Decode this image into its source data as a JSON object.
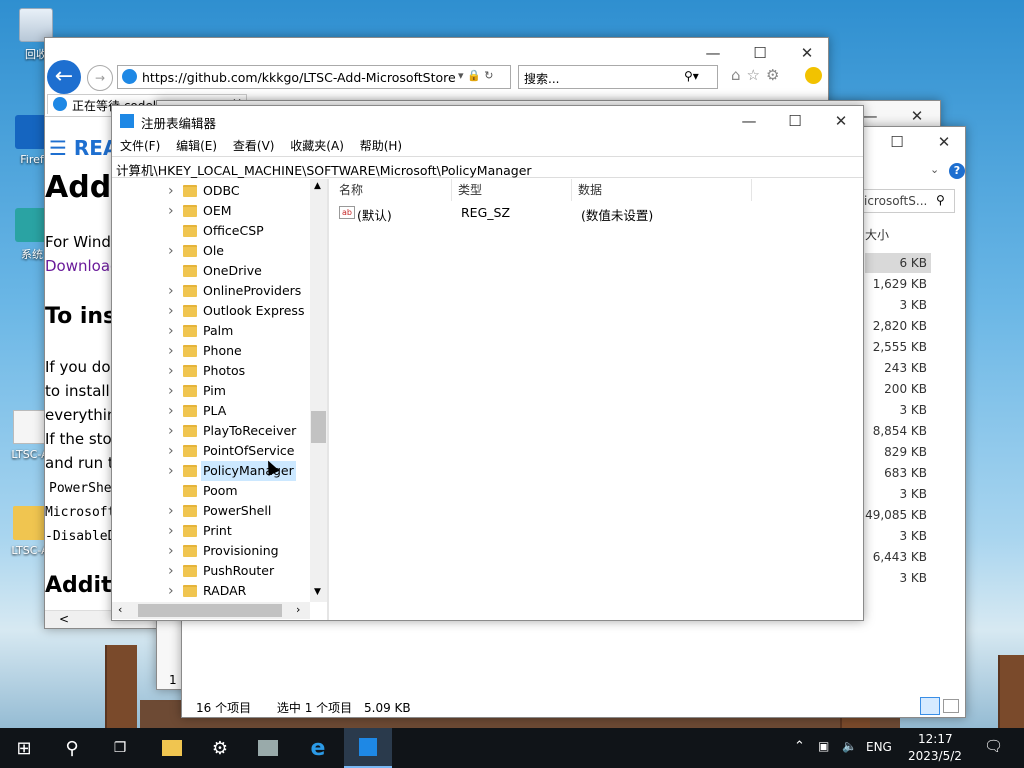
{
  "desktop": {
    "icons": [
      {
        "label": "回收"
      },
      {
        "label": "Firef"
      },
      {
        "label": "系统"
      },
      {
        "label": "LTSC-A"
      },
      {
        "label": "LTSC-A"
      }
    ]
  },
  "browser": {
    "url": "https://github.com/kkkgo/LTSC-Add-MicrosoftStore",
    "search_placeholder": "搜索...",
    "tab_label": "正在等待 codeload.githu",
    "page": {
      "readme": "REA",
      "heading": "Add",
      "line1": "For Windo",
      "download_link": "Download",
      "h2": "To ins",
      "p1": "If you do",
      "p2": "to install.",
      "p3": "everything",
      "p4": "If the stor",
      "p5": "and run th",
      "code1": "PowerShe",
      "code2": "Microsoft",
      "code3": "-DisableD",
      "h3": "Additi"
    }
  },
  "explorer": {
    "search_text": "icrosoftS...",
    "col_size": "大小",
    "sizes": [
      "6 KB",
      "1,629 KB",
      "3 KB",
      "2,820 KB",
      "2,555 KB",
      "243 KB",
      "200 KB",
      "3 KB",
      "8,854 KB",
      "829 KB",
      "683 KB",
      "3 KB",
      "49,085 KB",
      "3 KB",
      "6,443 KB",
      "3 KB"
    ],
    "status_count": "16 个项目",
    "status_selected": "选中 1 个项目",
    "status_size": "5.09 KB",
    "left_num": "1"
  },
  "regedit": {
    "title": "注册表编辑器",
    "menu": [
      "文件(F)",
      "编辑(E)",
      "查看(V)",
      "收藏夹(A)",
      "帮助(H)"
    ],
    "address": "计算机\\HKEY_LOCAL_MACHINE\\SOFTWARE\\Microsoft\\PolicyManager",
    "tree": [
      {
        "label": "ODBC",
        "expandable": true
      },
      {
        "label": "OEM",
        "expandable": true
      },
      {
        "label": "OfficeCSP",
        "expandable": false
      },
      {
        "label": "Ole",
        "expandable": true
      },
      {
        "label": "OneDrive",
        "expandable": false
      },
      {
        "label": "OnlineProviders",
        "expandable": true
      },
      {
        "label": "Outlook Express",
        "expandable": true
      },
      {
        "label": "Palm",
        "expandable": true
      },
      {
        "label": "Phone",
        "expandable": true
      },
      {
        "label": "Photos",
        "expandable": true
      },
      {
        "label": "Pim",
        "expandable": true
      },
      {
        "label": "PLA",
        "expandable": true
      },
      {
        "label": "PlayToReceiver",
        "expandable": true
      },
      {
        "label": "PointOfService",
        "expandable": true
      },
      {
        "label": "PolicyManager",
        "expandable": true,
        "selected": true
      },
      {
        "label": "Poom",
        "expandable": false
      },
      {
        "label": "PowerShell",
        "expandable": true
      },
      {
        "label": "Print",
        "expandable": true
      },
      {
        "label": "Provisioning",
        "expandable": true
      },
      {
        "label": "PushRouter",
        "expandable": true
      },
      {
        "label": "RADAR",
        "expandable": true
      }
    ],
    "columns": {
      "name": "名称",
      "type": "类型",
      "data": "数据"
    },
    "values": [
      {
        "name": "(默认)",
        "type": "REG_SZ",
        "data": "(数值未设置)"
      }
    ]
  },
  "taskbar": {
    "lang": "ENG",
    "time": "12:17",
    "date": "2023/5/2"
  },
  "colors": {
    "accent": "#0078d7",
    "selection": "#cce8ff",
    "link": "#6a1b9a"
  }
}
